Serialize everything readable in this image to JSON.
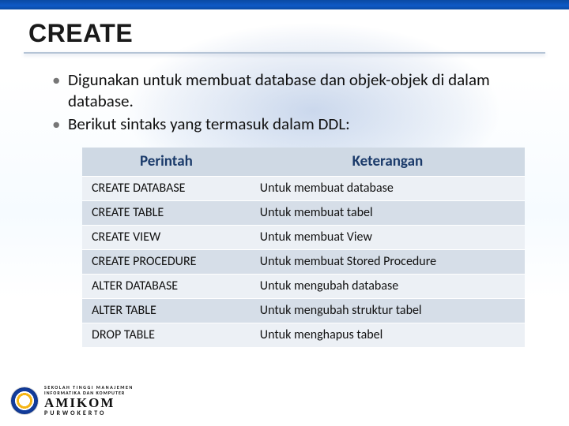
{
  "title": "CREATE",
  "bullets": [
    "Digunakan untuk membuat database dan objek-objek di dalam database.",
    "Berikut sintaks yang termasuk dalam DDL:"
  ],
  "table": {
    "headers": [
      "Perintah",
      "Keterangan"
    ],
    "rows": [
      [
        "CREATE DATABASE",
        "Untuk membuat database"
      ],
      [
        "CREATE TABLE",
        "Untuk membuat tabel"
      ],
      [
        "CREATE VIEW",
        "Untuk membuat View"
      ],
      [
        "CREATE PROCEDURE",
        "Untuk membuat Stored Procedure"
      ],
      [
        "ALTER DATABASE",
        "Untuk mengubah database"
      ],
      [
        "ALTER TABLE",
        "Untuk mengubah struktur tabel"
      ],
      [
        "DROP TABLE",
        "Untuk menghapus tabel"
      ]
    ]
  },
  "footer": {
    "line1": "SEKOLAH TINGGI MANAJEMEN",
    "line2": "INFORMATIKA DAN KOMPUTER",
    "main": "AMIKOM",
    "sub": "PURWOKERTO"
  }
}
